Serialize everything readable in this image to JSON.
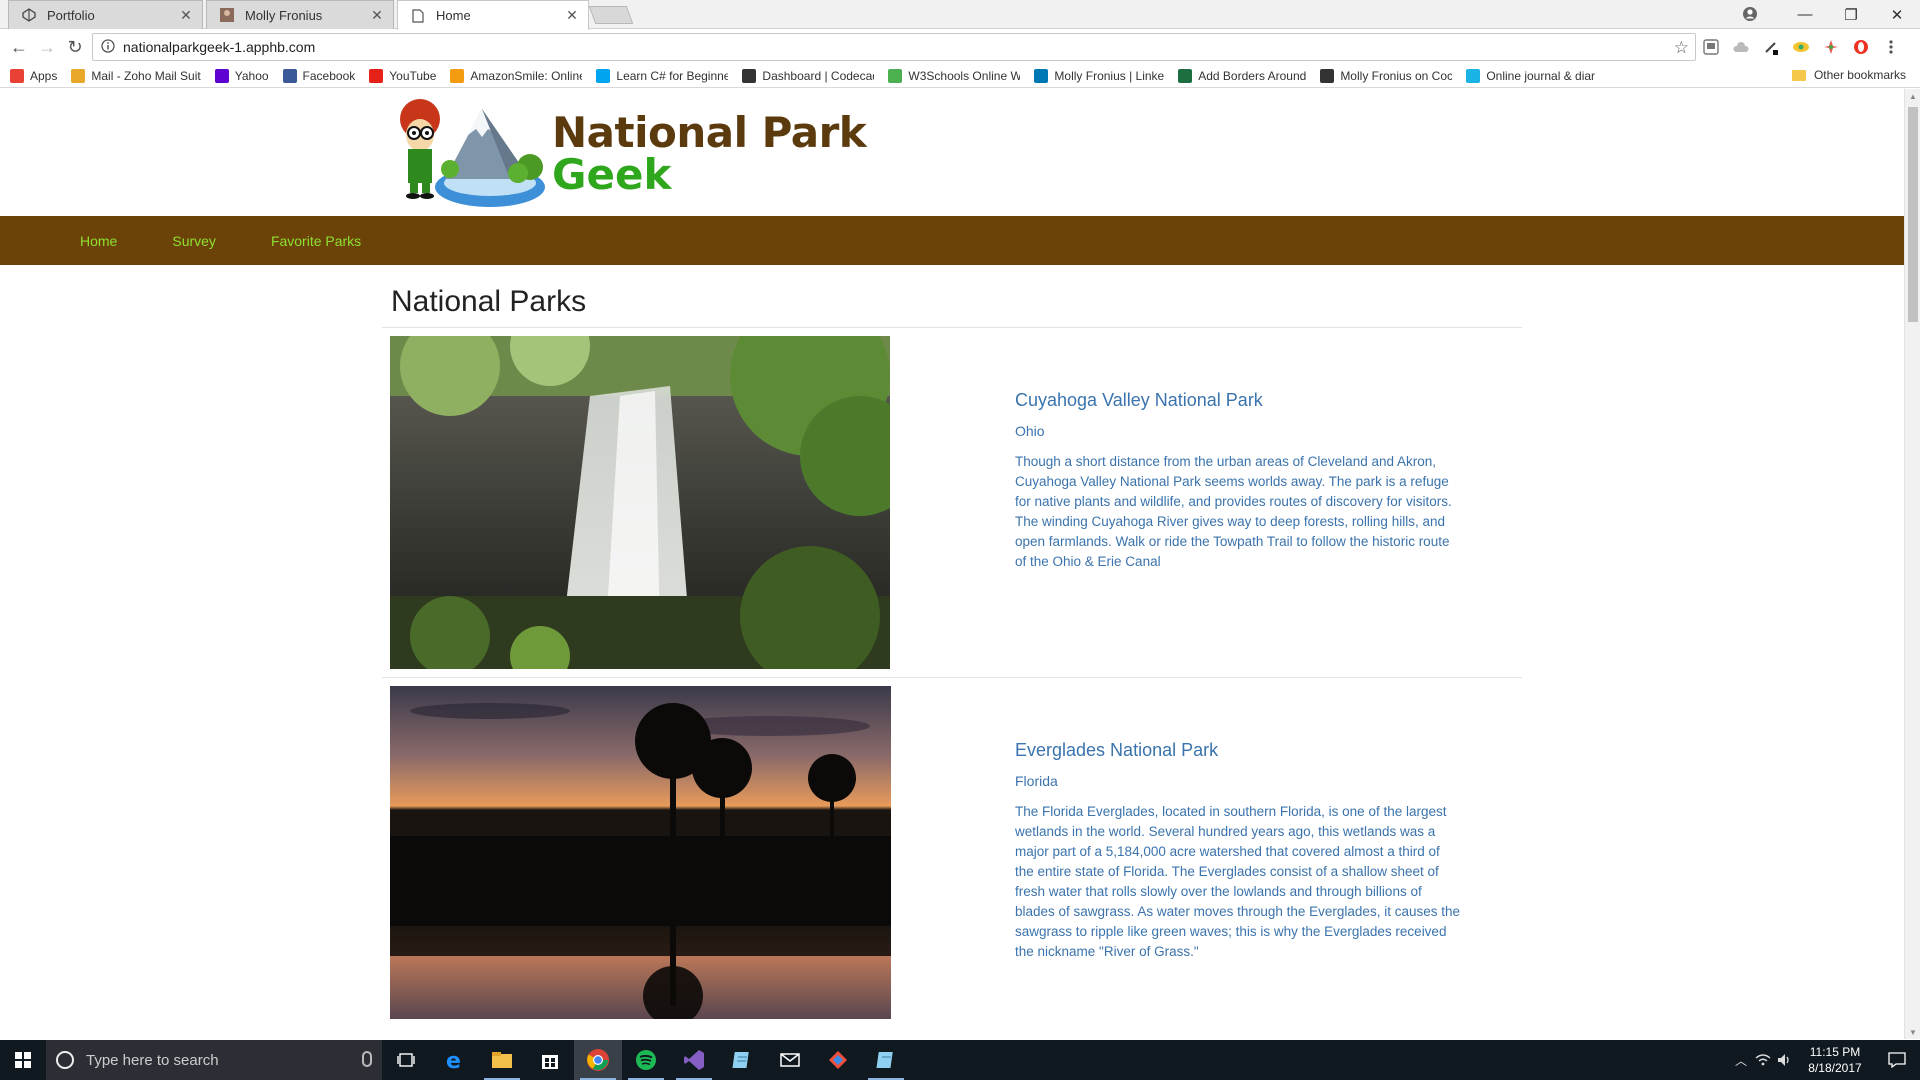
{
  "browser": {
    "tabs": [
      {
        "label": "Portfolio",
        "active": false
      },
      {
        "label": "Molly Fronius",
        "active": false
      },
      {
        "label": "Home",
        "active": true
      }
    ],
    "url": "nationalparkgeek-1.apphb.com",
    "bookmarks": [
      {
        "label": "Apps",
        "icon": "apps-grid-icon",
        "color": "#e94235"
      },
      {
        "label": "Mail - Zoho Mail Suit",
        "icon": "zoho-mail-icon",
        "color": "#e8a92a"
      },
      {
        "label": "Yahoo",
        "icon": "yahoo-icon",
        "color": "#5f01d1"
      },
      {
        "label": "Facebook",
        "icon": "facebook-icon",
        "color": "#3b5998"
      },
      {
        "label": "YouTube",
        "icon": "youtube-icon",
        "color": "#e62117"
      },
      {
        "label": "AmazonSmile: Online",
        "icon": "amazon-icon",
        "color": "#f39c12"
      },
      {
        "label": "Learn C# for Beginne",
        "icon": "microsoft-icon",
        "color": "#00a4ef"
      },
      {
        "label": "Dashboard | Codecad",
        "icon": "codecademy-icon",
        "color": "#333333"
      },
      {
        "label": "W3Schools Online W",
        "icon": "w3schools-icon",
        "color": "#4caf50"
      },
      {
        "label": "Molly Fronius | Linke",
        "icon": "linkedin-icon",
        "color": "#0077b5"
      },
      {
        "label": "Add Borders Around",
        "icon": "sheet-icon",
        "color": "#1d6f42"
      },
      {
        "label": "Molly Fronius on Coc",
        "icon": "codepen-icon",
        "color": "#333333"
      },
      {
        "label": "Online journal & diar",
        "icon": "cloud-icon",
        "color": "#1ab3e6"
      }
    ],
    "other_bookmarks": "Other bookmarks"
  },
  "site": {
    "logo_line1": "National Park",
    "logo_line2": "Geek",
    "nav": [
      "Home",
      "Survey",
      "Favorite Parks"
    ],
    "page_title": "National Parks",
    "parks": [
      {
        "name": "Cuyahoga Valley National Park",
        "state": "Ohio",
        "description": "Though a short distance from the urban areas of Cleveland and Akron, Cuyahoga Valley National Park seems worlds away. The park is a refuge for native plants and wildlife, and provides routes of discovery for visitors. The winding Cuyahoga River gives way to deep forests, rolling hills, and open farmlands. Walk or ride the Towpath Trail to follow the historic route of the Ohio & Erie Canal"
      },
      {
        "name": "Everglades National Park",
        "state": "Florida",
        "description": "The Florida Everglades, located in southern Florida, is one of the largest wetlands in the world. Several hundred years ago, this wetlands was a major part of a 5,184,000 acre watershed that covered almost a third of the entire state of Florida. The Everglades consist of a shallow sheet of fresh water that rolls slowly over the lowlands and through billions of blades of sawgrass. As water moves through the Everglades, it causes the sawgrass to ripple like green waves; this is why the Everglades received the nickname \"River of Grass.\""
      }
    ]
  },
  "taskbar": {
    "search_placeholder": "Type here to search",
    "time": "11:15 PM",
    "date": "8/18/2017"
  },
  "colors": {
    "nav_bg": "#6b4208",
    "nav_link": "#8ee02f",
    "park_text": "#3a73ad",
    "logo_brown": "#5b3a0e",
    "logo_green": "#2fa71c"
  }
}
